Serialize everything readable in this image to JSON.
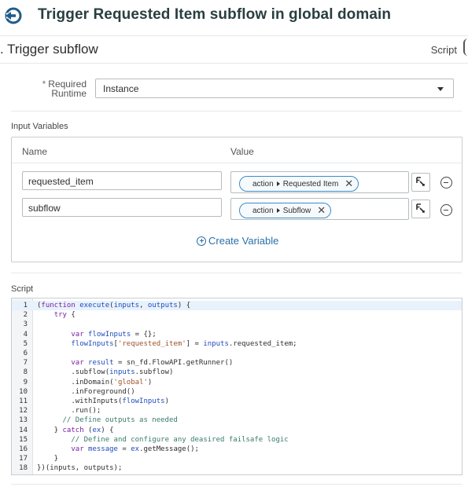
{
  "header": {
    "title": "Trigger Requested Item subflow in global domain",
    "back_icon": "circle-arrow-left-icon",
    "icon_color": "#1f5c8b"
  },
  "step": {
    "title": ". Trigger subflow",
    "type_label": "Script"
  },
  "runtime": {
    "label_asterisk": "*",
    "label_line1": "Required",
    "label_line2": "Runtime",
    "selected": "Instance"
  },
  "input_variables": {
    "section_label": "Input Variables",
    "col_name": "Name",
    "col_value": "Value",
    "rows": [
      {
        "name": "requested_item",
        "pill_source": "action",
        "pill_field": "Requested Item"
      },
      {
        "name": "subflow",
        "pill_source": "action",
        "pill_field": "Subflow"
      }
    ],
    "create_label": "Create Variable"
  },
  "script": {
    "section_label": "Script",
    "active_line": 1,
    "lines": [
      {
        "n": "1",
        "tokens": [
          [
            "(",
            "t-plain"
          ],
          [
            "function",
            "t-kw"
          ],
          [
            " ",
            "t-plain"
          ],
          [
            "execute",
            "t-blue"
          ],
          [
            "(",
            "t-plain"
          ],
          [
            "inputs",
            "t-blue"
          ],
          [
            ", ",
            "t-plain"
          ],
          [
            "outputs",
            "t-blue"
          ],
          [
            ") {",
            "t-plain"
          ]
        ]
      },
      {
        "n": "2",
        "tokens": [
          [
            "    ",
            "t-plain"
          ],
          [
            "try",
            "t-kw"
          ],
          [
            " {",
            "t-plain"
          ]
        ]
      },
      {
        "n": "3",
        "tokens": []
      },
      {
        "n": "4",
        "tokens": [
          [
            "        ",
            "t-plain"
          ],
          [
            "var",
            "t-kw"
          ],
          [
            " ",
            "t-plain"
          ],
          [
            "flowInputs",
            "t-blue"
          ],
          [
            " = {};",
            "t-plain"
          ]
        ]
      },
      {
        "n": "5",
        "tokens": [
          [
            "        ",
            "t-plain"
          ],
          [
            "flowInputs",
            "t-blue"
          ],
          [
            "[",
            "t-plain"
          ],
          [
            "'requested_item'",
            "t-str"
          ],
          [
            "] = ",
            "t-plain"
          ],
          [
            "inputs",
            "t-blue"
          ],
          [
            ".requested_item;",
            "t-plain"
          ]
        ]
      },
      {
        "n": "6",
        "tokens": []
      },
      {
        "n": "7",
        "tokens": [
          [
            "        ",
            "t-plain"
          ],
          [
            "var",
            "t-kw"
          ],
          [
            " ",
            "t-plain"
          ],
          [
            "result",
            "t-blue"
          ],
          [
            " = sn_fd.FlowAPI.getRunner()",
            "t-plain"
          ]
        ]
      },
      {
        "n": "8",
        "tokens": [
          [
            "        .subflow(",
            "t-plain"
          ],
          [
            "inputs",
            "t-blue"
          ],
          [
            ".subflow)",
            "t-plain"
          ]
        ]
      },
      {
        "n": "9",
        "tokens": [
          [
            "        .inDomain(",
            "t-plain"
          ],
          [
            "'global'",
            "t-str"
          ],
          [
            ")",
            "t-plain"
          ]
        ]
      },
      {
        "n": "10",
        "tokens": [
          [
            "        .inForeground()",
            "t-plain"
          ]
        ]
      },
      {
        "n": "11",
        "tokens": [
          [
            "        .withInputs(",
            "t-plain"
          ],
          [
            "flowInputs",
            "t-blue"
          ],
          [
            ")",
            "t-plain"
          ]
        ]
      },
      {
        "n": "12",
        "tokens": [
          [
            "        .run();",
            "t-plain"
          ]
        ]
      },
      {
        "n": "13",
        "tokens": [
          [
            "      ",
            "t-plain"
          ],
          [
            "// Define outputs as needed",
            "t-cm"
          ]
        ]
      },
      {
        "n": "14",
        "tokens": [
          [
            "    } ",
            "t-plain"
          ],
          [
            "catch",
            "t-kw"
          ],
          [
            " (",
            "t-plain"
          ],
          [
            "ex",
            "t-blue"
          ],
          [
            ") {",
            "t-plain"
          ]
        ]
      },
      {
        "n": "15",
        "tokens": [
          [
            "        ",
            "t-plain"
          ],
          [
            "// Define and configure any deasired failsafe logic",
            "t-cm"
          ]
        ]
      },
      {
        "n": "16",
        "tokens": [
          [
            "        ",
            "t-plain"
          ],
          [
            "var",
            "t-kw"
          ],
          [
            " ",
            "t-plain"
          ],
          [
            "message",
            "t-blue"
          ],
          [
            " = ",
            "t-plain"
          ],
          [
            "ex",
            "t-blue"
          ],
          [
            ".getMessage();",
            "t-plain"
          ]
        ]
      },
      {
        "n": "17",
        "tokens": [
          [
            "    }",
            "t-plain"
          ]
        ]
      },
      {
        "n": "18",
        "tokens": [
          [
            "})(inputs, outputs);",
            "t-plain"
          ]
        ]
      }
    ]
  }
}
